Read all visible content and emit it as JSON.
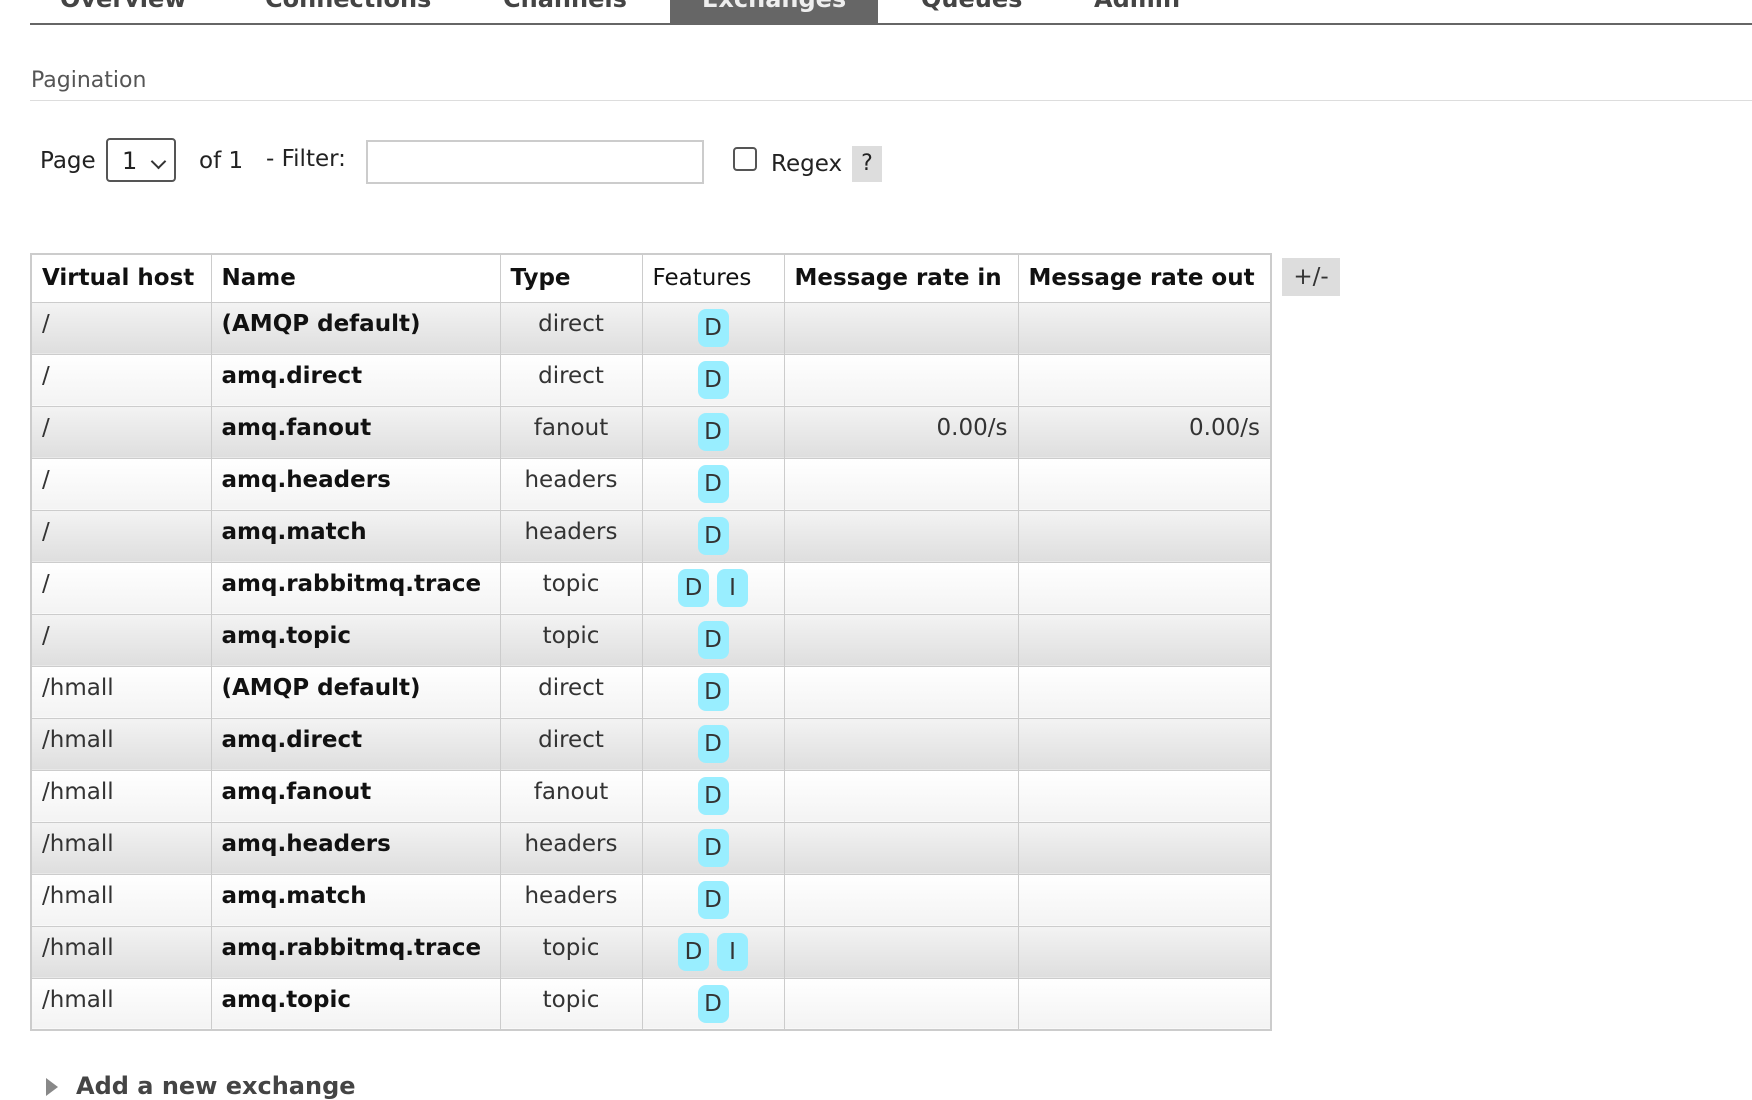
{
  "nav": {
    "tabs": [
      {
        "label": "Overview"
      },
      {
        "label": "Connections"
      },
      {
        "label": "Channels"
      },
      {
        "label": "Exchanges"
      },
      {
        "label": "Queues"
      },
      {
        "label": "Admin"
      }
    ],
    "active_tab": "Exchanges"
  },
  "pagination": {
    "title": "Pagination",
    "page_label": "Page",
    "page_value": "1",
    "of_label": "of 1",
    "filter_label": "- Filter:",
    "filter_value": "",
    "regex_label": "Regex",
    "regex_checked": false,
    "help_label": "?"
  },
  "table": {
    "columns": [
      "Virtual host",
      "Name",
      "Type",
      "Features",
      "Message rate in",
      "Message rate out"
    ],
    "toggle_label": "+/-",
    "rows": [
      {
        "vhost": "/",
        "name": "(AMQP default)",
        "type": "direct",
        "features": [
          "D"
        ],
        "rate_in": "",
        "rate_out": ""
      },
      {
        "vhost": "/",
        "name": "amq.direct",
        "type": "direct",
        "features": [
          "D"
        ],
        "rate_in": "",
        "rate_out": ""
      },
      {
        "vhost": "/",
        "name": "amq.fanout",
        "type": "fanout",
        "features": [
          "D"
        ],
        "rate_in": "0.00/s",
        "rate_out": "0.00/s"
      },
      {
        "vhost": "/",
        "name": "amq.headers",
        "type": "headers",
        "features": [
          "D"
        ],
        "rate_in": "",
        "rate_out": ""
      },
      {
        "vhost": "/",
        "name": "amq.match",
        "type": "headers",
        "features": [
          "D"
        ],
        "rate_in": "",
        "rate_out": ""
      },
      {
        "vhost": "/",
        "name": "amq.rabbitmq.trace",
        "type": "topic",
        "features": [
          "D",
          "I"
        ],
        "rate_in": "",
        "rate_out": ""
      },
      {
        "vhost": "/",
        "name": "amq.topic",
        "type": "topic",
        "features": [
          "D"
        ],
        "rate_in": "",
        "rate_out": ""
      },
      {
        "vhost": "/hmall",
        "name": "(AMQP default)",
        "type": "direct",
        "features": [
          "D"
        ],
        "rate_in": "",
        "rate_out": ""
      },
      {
        "vhost": "/hmall",
        "name": "amq.direct",
        "type": "direct",
        "features": [
          "D"
        ],
        "rate_in": "",
        "rate_out": ""
      },
      {
        "vhost": "/hmall",
        "name": "amq.fanout",
        "type": "fanout",
        "features": [
          "D"
        ],
        "rate_in": "",
        "rate_out": ""
      },
      {
        "vhost": "/hmall",
        "name": "amq.headers",
        "type": "headers",
        "features": [
          "D"
        ],
        "rate_in": "",
        "rate_out": ""
      },
      {
        "vhost": "/hmall",
        "name": "amq.match",
        "type": "headers",
        "features": [
          "D"
        ],
        "rate_in": "",
        "rate_out": ""
      },
      {
        "vhost": "/hmall",
        "name": "amq.rabbitmq.trace",
        "type": "topic",
        "features": [
          "D",
          "I"
        ],
        "rate_in": "",
        "rate_out": ""
      },
      {
        "vhost": "/hmall",
        "name": "amq.topic",
        "type": "topic",
        "features": [
          "D"
        ],
        "rate_in": "",
        "rate_out": ""
      }
    ]
  },
  "add_exchange": {
    "label": "Add a new exchange"
  },
  "colors": {
    "feature_badge": "#99eeff",
    "active_tab_bg": "#666666",
    "border": "#cccccc"
  },
  "icons": {
    "page_select": "chevron-down-icon",
    "add_exchange": "triangle-right-icon"
  }
}
